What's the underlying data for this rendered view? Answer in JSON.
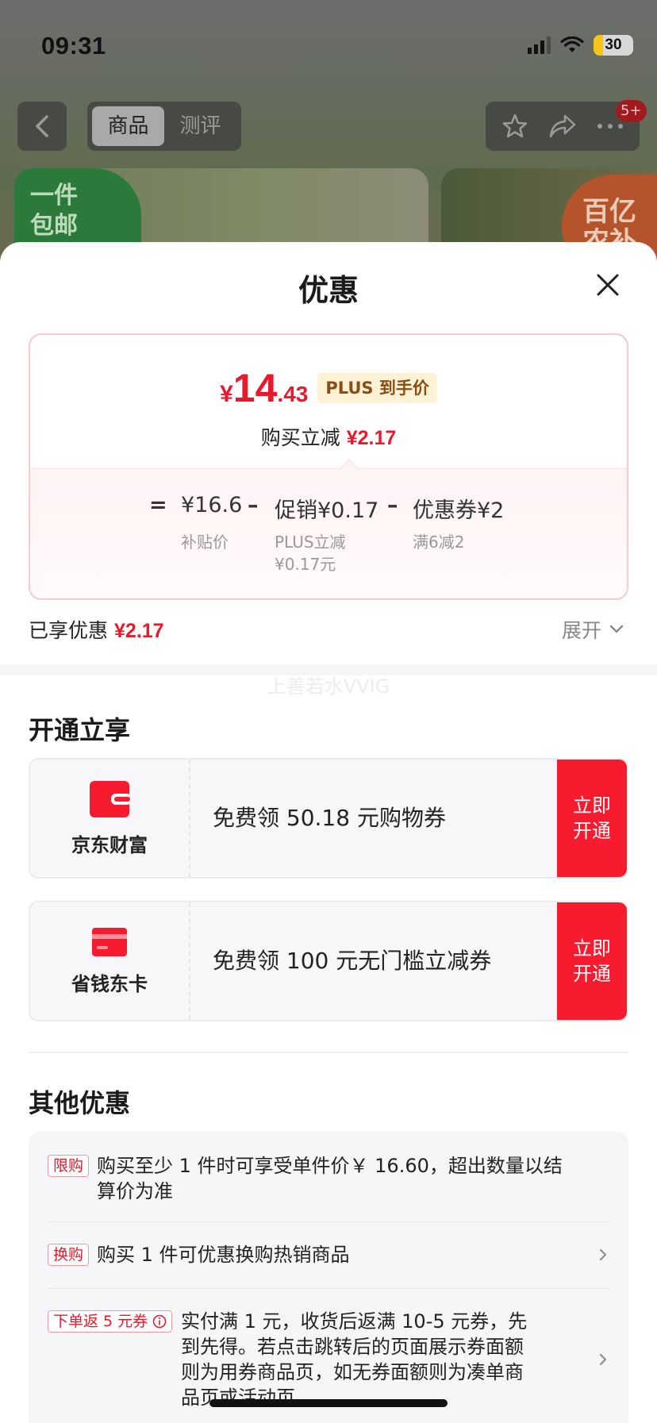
{
  "status_bar": {
    "time": "09:31",
    "battery": "30"
  },
  "nav": {
    "tabs": [
      "商品",
      "测评"
    ],
    "badge": "5+"
  },
  "background": {
    "promo_left": "一件\n包邮",
    "promo_right": "百亿\n农补"
  },
  "sheet": {
    "title": "优惠",
    "price_card": {
      "currency": "¥",
      "price_int": "14",
      "price_dec": ".43",
      "plus_tag": "PLUS 到手价",
      "reduce_label": "购买立减",
      "reduce_amount": "¥2.17",
      "calc": {
        "equals": "=",
        "base": "¥16.6",
        "minus1": "–",
        "promo": "促销¥0.17",
        "minus2": "–",
        "coupon": "优惠券¥2",
        "base_label": "补贴价",
        "promo_label_1": "PLUS立减",
        "promo_label_2": "¥0.17元",
        "coupon_label": "满6减2"
      }
    },
    "enjoyed_label": "已享优惠",
    "enjoyed_amount": "¥2.17",
    "expand_label": "展开",
    "watermark": "上善若水VVIG",
    "open_section": {
      "title": "开通立享",
      "cards": [
        {
          "brand": "京东财富",
          "desc": "免费领 50.18 元购物券",
          "cta_1": "立即",
          "cta_2": "开通"
        },
        {
          "brand": "省钱东卡",
          "desc": "免费领 100 元无门槛立减券",
          "cta_1": "立即",
          "cta_2": "开通"
        }
      ]
    },
    "other_section": {
      "title": "其他优惠",
      "rows": [
        {
          "tag": "限购",
          "line1": "购买至少 1 件时可享受单件价￥ 16.60，超出数量以结",
          "line2": "算价为准"
        },
        {
          "tag": "换购",
          "line1": "购买 1 件可优惠换购热销商品"
        },
        {
          "tag": "下单返 5 元券",
          "line1": "实付满 1 元，收货后返满 10-5 元券，先",
          "line2": "到先得。若点击跳转后的页面展示券面额",
          "line3": "则为用券商品页，如无券面额则为凑单商",
          "line4": "品页或活动页。"
        }
      ]
    }
  },
  "colors": {
    "accent_red": "#e8192c",
    "cta_red": "#f61b2e",
    "plus_gold": "#8a4d12"
  }
}
